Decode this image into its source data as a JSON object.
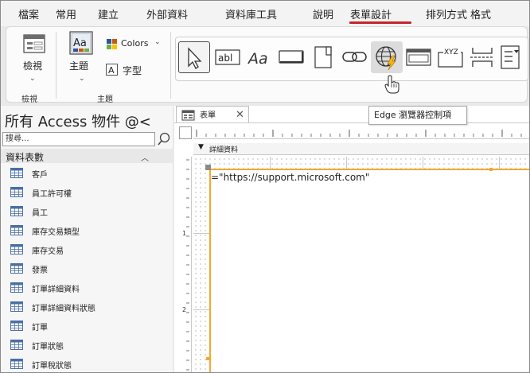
{
  "menu": {
    "items": [
      "檔案",
      "常用",
      "建立",
      "外部資料",
      "資料庫工具",
      "說明",
      "表單設計",
      "排列方式",
      "格式"
    ],
    "active": "表單設計"
  },
  "ribbon": {
    "view_group": {
      "button_label": "檢視",
      "group_label": "檢視"
    },
    "theme_group": {
      "theme_label": "主題",
      "colors_label": "Colors",
      "fonts_label": "字型",
      "group_label": "主題"
    },
    "controls": [
      {
        "name": "select",
        "icon": "pointer-icon"
      },
      {
        "name": "textbox",
        "icon": "textbox-icon",
        "glyph": "abl"
      },
      {
        "name": "label",
        "icon": "label-icon",
        "glyph": "Aa"
      },
      {
        "name": "button",
        "icon": "button-icon"
      },
      {
        "name": "tab",
        "icon": "tab-control-icon"
      },
      {
        "name": "hyperlink",
        "icon": "link-icon"
      },
      {
        "name": "web-browser",
        "icon": "edge-browser-icon"
      },
      {
        "name": "navigation",
        "icon": "navigation-control-icon"
      },
      {
        "name": "option-group",
        "icon": "option-group-icon",
        "glyph": "XYZ"
      },
      {
        "name": "page-break",
        "icon": "page-break-icon"
      },
      {
        "name": "combo",
        "icon": "combobox-icon"
      }
    ],
    "tooltip": "Edge 瀏覽器控制項"
  },
  "nav": {
    "title": "所有 Access 物件 @<",
    "search_placeholder": "搜尋...",
    "group_label": "資料表數",
    "items": [
      "客戶",
      "員工許可權",
      "員工",
      "庫存交易類型",
      "庫存交易",
      "發票",
      "訂單詳細資料",
      "訂單詳細資料狀態",
      "訂單",
      "訂單狀態",
      "訂單稅狀態"
    ]
  },
  "document": {
    "tab_label": "表單",
    "section_label": "詳細資料",
    "control_source": "=\"https://support.microsoft.com\"",
    "ruler_left_numbers": [
      "1",
      "2"
    ]
  },
  "colors": {
    "accent_red": "#c4262e",
    "selection_orange": "#f5a733"
  }
}
